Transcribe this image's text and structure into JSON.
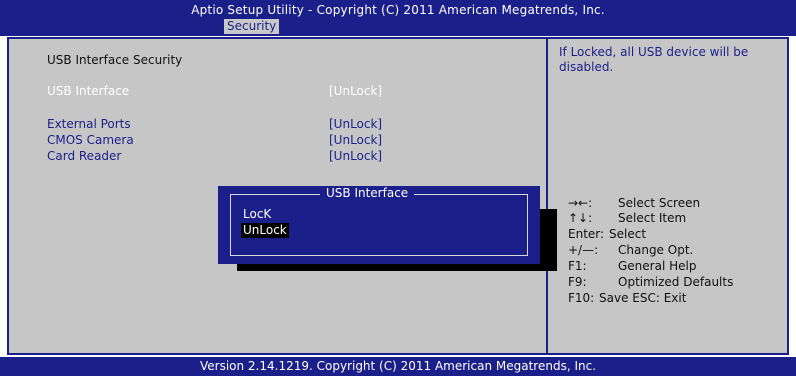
{
  "header": {
    "title": "Aptio Setup Utility - Copyright (C) 2011 American Megatrends, Inc.",
    "active_tab": "Security"
  },
  "main": {
    "section_title": "USB Interface Security",
    "items": [
      {
        "label": "USB Interface",
        "value": "[UnLock]"
      },
      {
        "label": "External Ports",
        "value": "[UnLock]"
      },
      {
        "label": "CMOS Camera",
        "value": "[UnLock]"
      },
      {
        "label": "Card Reader",
        "value": "[UnLock]"
      }
    ]
  },
  "help_text": "If Locked, all USB device will be disabled.",
  "keys": [
    {
      "key": "→←:",
      "desc": "Select Screen"
    },
    {
      "key": "↑↓:",
      "desc": "Select Item"
    },
    {
      "key": "Enter:",
      "desc": "Select"
    },
    {
      "key": "+/—:",
      "desc": "Change Opt."
    },
    {
      "key": "F1:",
      "desc": "General Help"
    },
    {
      "key": "F9:",
      "desc": "Optimized Defaults"
    },
    {
      "key": "F10:",
      "desc": "Save   ESC: Exit"
    }
  ],
  "popup": {
    "title": "USB Interface",
    "options": [
      "LocK",
      "UnLock"
    ],
    "selected": "UnLock"
  },
  "footer": "Version 2.14.1219. Copyright (C) 2011 American Megatrends, Inc.",
  "colors": {
    "bios_blue": "#1a1f8a",
    "panel_gray": "#c6c6c6",
    "highlight_white": "#ffffff"
  }
}
